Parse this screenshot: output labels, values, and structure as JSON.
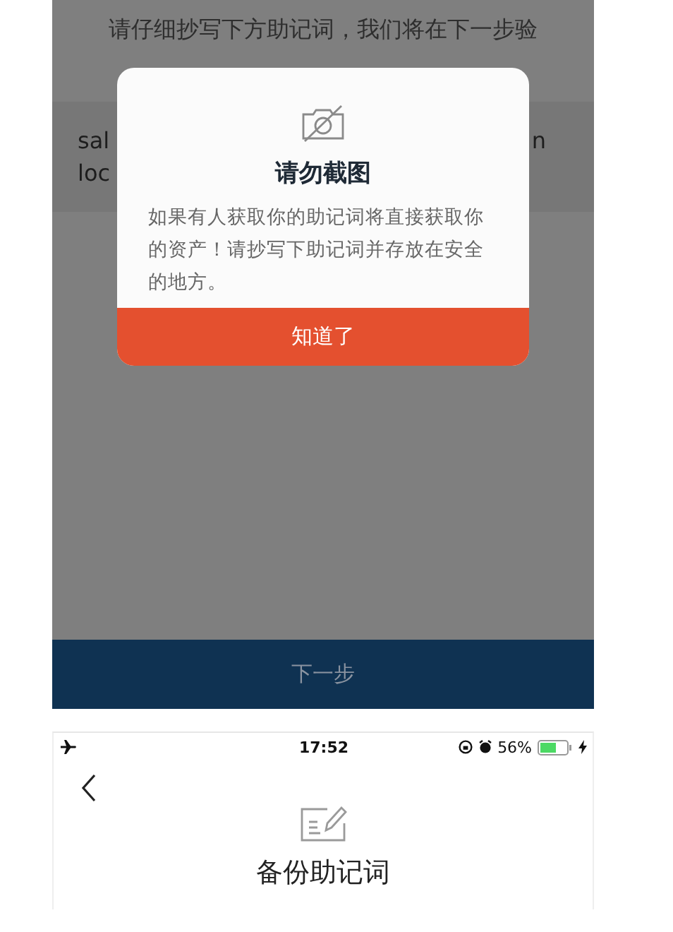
{
  "verify_screen": {
    "instruction": "请仔细抄写下方助记词，我们将在下一步验",
    "mnemonic_fragments": {
      "left": [
        "sal",
        "loc"
      ],
      "right": [
        "n"
      ]
    },
    "next_button": "下一步",
    "dialog": {
      "title": "请勿截图",
      "message": "如果有人获取你的助记词将直接获取你的资产！请抄写下助记词并存放在安全的地方。",
      "confirm_button": "知道了"
    }
  },
  "backup_screen": {
    "status_bar": {
      "time": "17:52",
      "battery_percent": "56%"
    },
    "title": "备份助记词"
  }
}
